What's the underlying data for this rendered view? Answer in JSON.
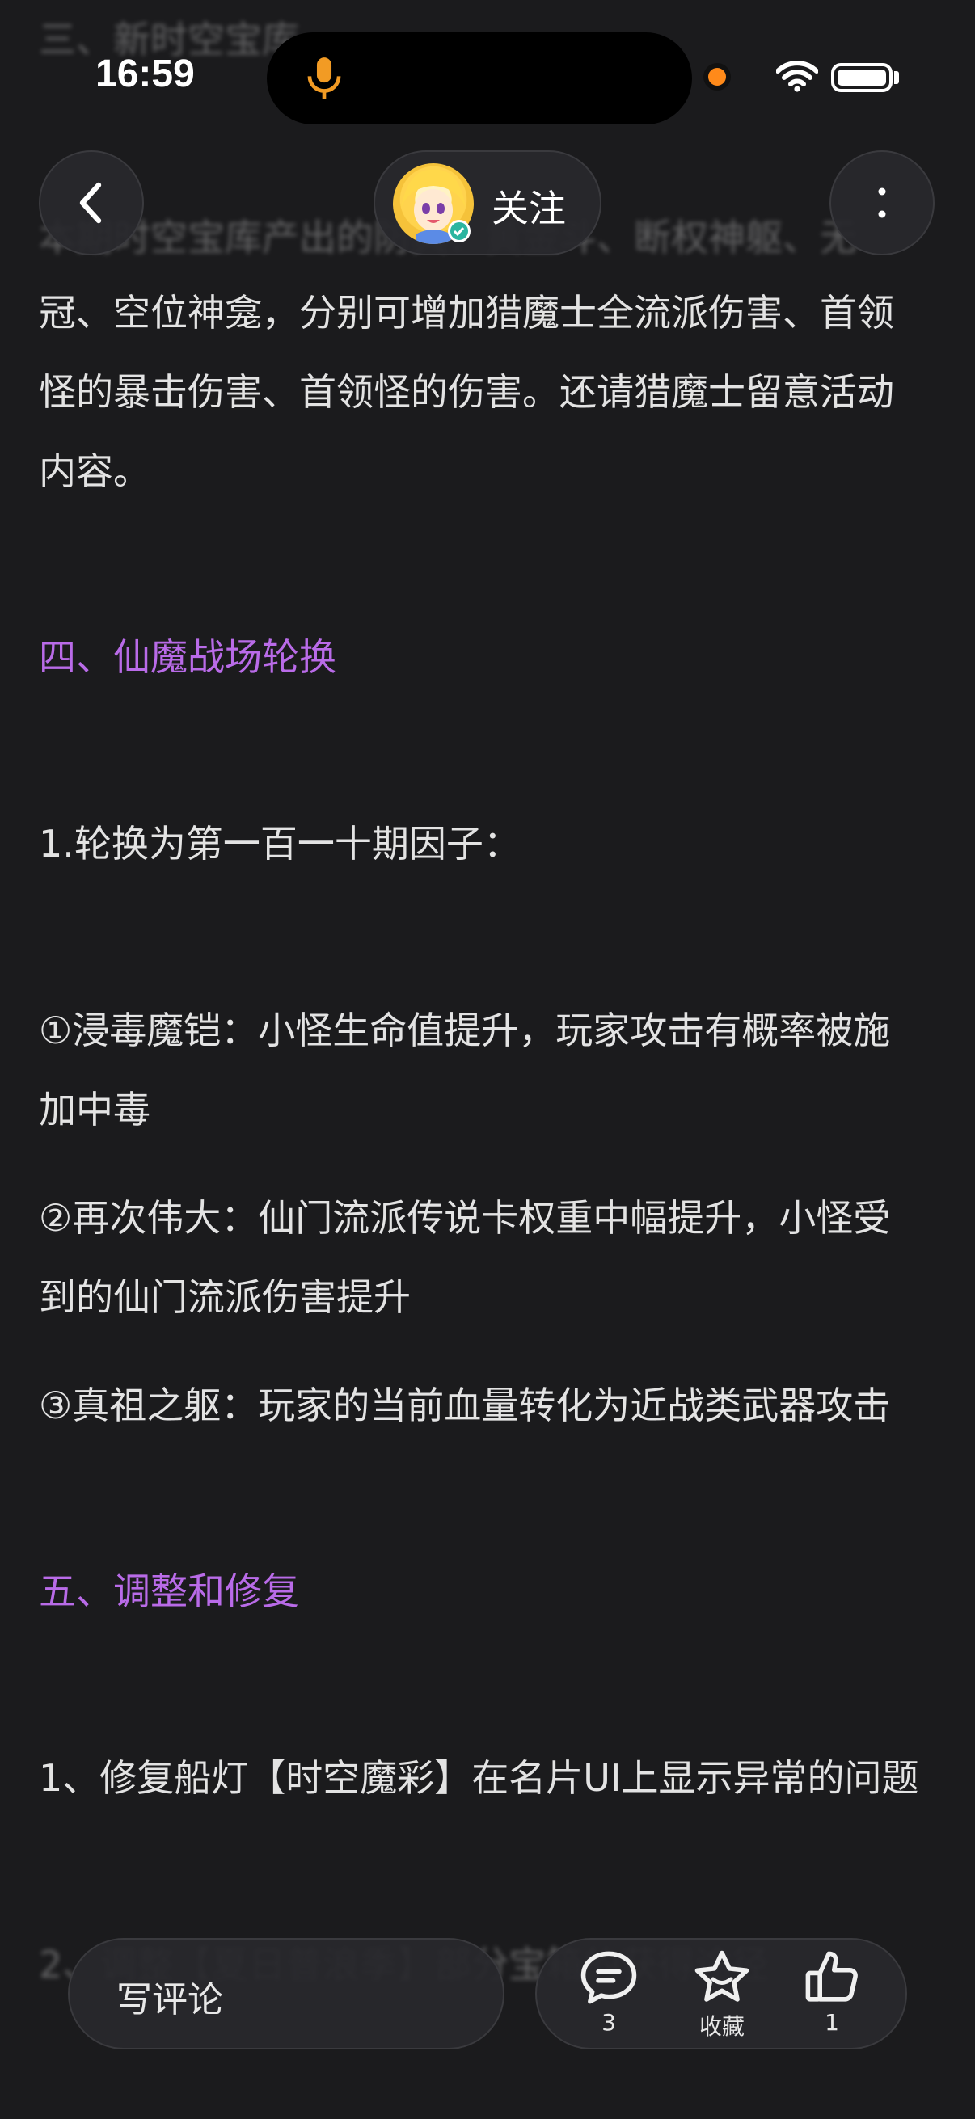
{
  "status_bar": {
    "time": "16:59"
  },
  "nav": {
    "follow_label": "关注"
  },
  "article": {
    "top_faded_1": "三、新时空宝库",
    "top_faded_2": "本期时空宝库产出的防具：黄金斗、断权神躯、无",
    "p1_line1": "冠、空位神龛，分别可增加猎魔士全流派伤害、首领",
    "p1_line2": "怪的暴击伤害、首领怪的伤害。还请猎魔士留意活动",
    "p1_line3": "内容。",
    "heading4": "四、仙魔战场轮换",
    "sub1": "1.轮换为第一百一十期因子：",
    "item1_line1": "①浸毒魔铠：小怪生命值提升，玩家攻击有概率被施",
    "item1_line2": "加中毒",
    "item2_line1": "②再次伟大：仙门流派传说卡权重中幅提升，小怪受",
    "item2_line2": "到的仙门流派伤害提升",
    "item3_line1": "③真祖之躯：玩家的当前血量转化为近战类武器攻击",
    "heading5": "五、调整和修复",
    "fix1": "1、修复船灯【时空魔彩】在名片UI上显示异常的问题",
    "fix2_faded": "2、调整【夏日普浪季】部分宝箱的获得途径"
  },
  "bottom_bar": {
    "comment_placeholder": "写评论",
    "comments_count": "3",
    "favorite_label": "收藏",
    "likes_count": "1"
  },
  "colors": {
    "background": "#1b1b1d",
    "heading_accent": "#b96be8",
    "text": "#e3e3e3",
    "camera_indicator": "#ff8a1a"
  }
}
